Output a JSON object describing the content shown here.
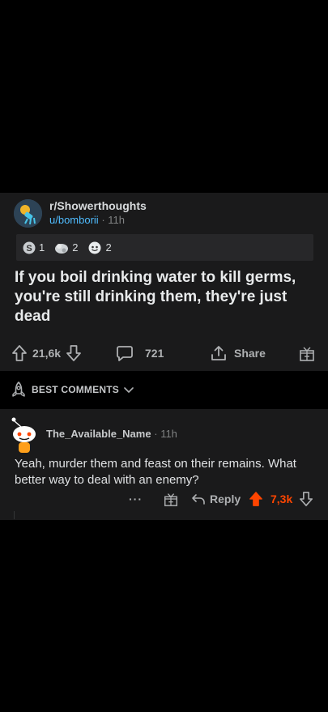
{
  "post": {
    "subreddit": "r/Showerthoughts",
    "user": "u/bomborii",
    "separator": "·",
    "age": "11h",
    "awards": [
      {
        "icon": "silver-award-icon",
        "count": "1"
      },
      {
        "icon": "helpful-award-icon",
        "count": "2"
      },
      {
        "icon": "wholesome-award-icon",
        "count": "2"
      }
    ],
    "title": "If you boil drinking water to kill germs, you're still drinking them, they're just dead",
    "score": "21,6k",
    "comments": "721",
    "share_label": "Share"
  },
  "sort": {
    "label": "BEST COMMENTS"
  },
  "comment": {
    "author": "The_Available_Name",
    "separator": "·",
    "age": "11h",
    "body": "Yeah, murder them and feast on their remains. What better way to deal with an enemy?",
    "more": "···",
    "reply_label": "Reply",
    "score": "7,3k",
    "score_color": "#ff4500"
  },
  "colors": {
    "background": "#000000",
    "card": "#1a1a1b",
    "link": "#4fbcff",
    "upvote": "#ff4500"
  }
}
